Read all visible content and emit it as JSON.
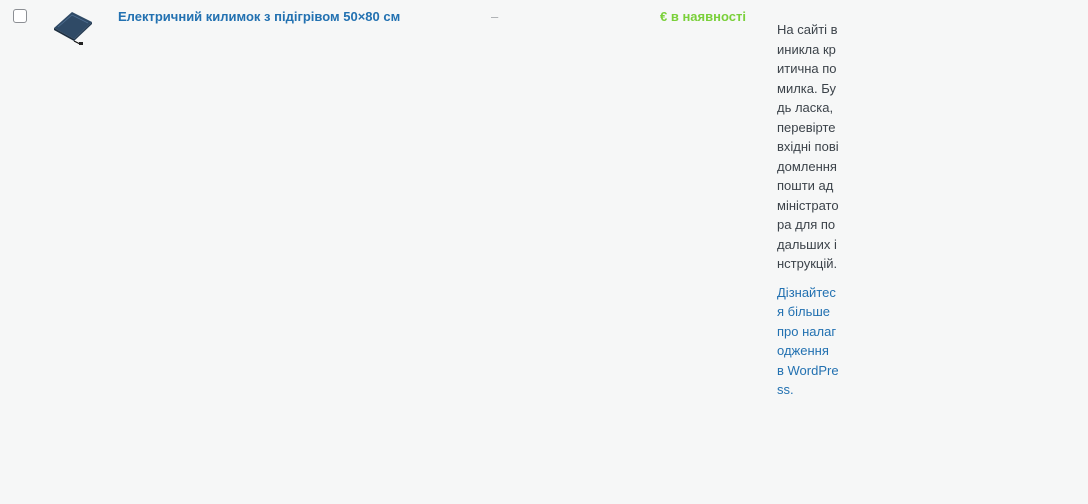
{
  "row": {
    "thumbnail_icon": "heated-mat-thumbnail",
    "product_name": "Електричний килимок з підігрівом 50×80 см",
    "sku": "–",
    "stock_status": "€ в наявності",
    "stock_color": "#7ad03a",
    "link_color": "#2271b1"
  },
  "error": {
    "message": "На сайті виникла критична помилка. Будь ласка, перевірте вхідні повідомлення пошти адміністратора для подальших інструкцій.",
    "link_text": "Дізнайтеся більше про налагодження в WordPress."
  }
}
